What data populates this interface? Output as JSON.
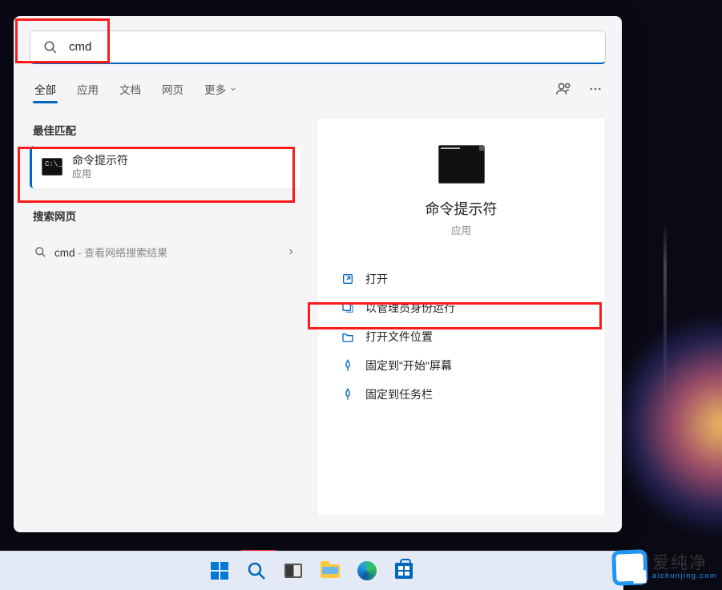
{
  "search": {
    "query": "cmd",
    "placeholder": ""
  },
  "tabs": {
    "all": "全部",
    "apps": "应用",
    "documents": "文档",
    "web": "网页",
    "more": "更多"
  },
  "sections": {
    "best_match": "最佳匹配",
    "search_web": "搜索网页"
  },
  "best_match": {
    "title": "命令提示符",
    "subtitle": "应用"
  },
  "web_result": {
    "query_highlight": "cmd",
    "suffix": " - 查看网络搜索结果"
  },
  "preview": {
    "title": "命令提示符",
    "subtitle": "应用"
  },
  "actions": {
    "open": "打开",
    "run_as_admin": "以管理员身份运行",
    "open_location": "打开文件位置",
    "pin_start": "固定到\"开始\"屏幕",
    "pin_taskbar": "固定到任务栏"
  },
  "watermark": {
    "text": "爱纯净",
    "domain": "aichunjing.com"
  }
}
